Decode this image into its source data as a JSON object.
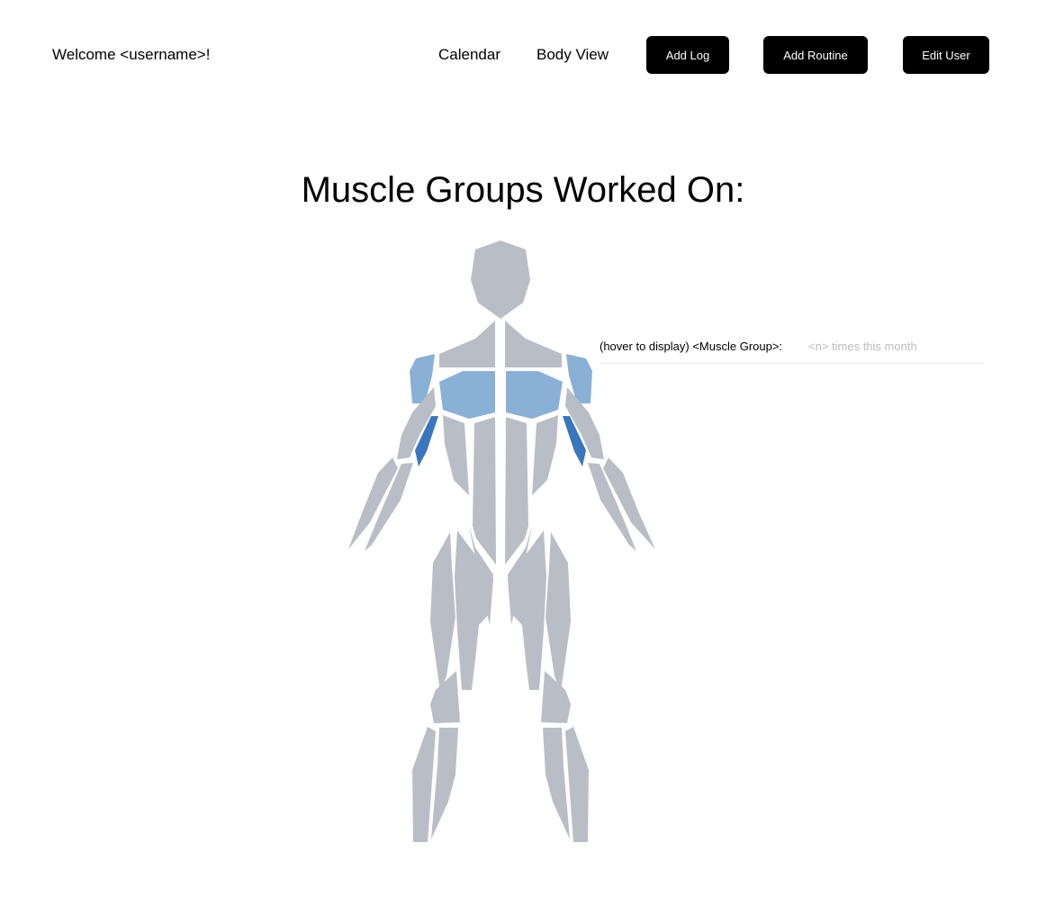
{
  "header": {
    "welcome": "Welcome <username>!",
    "nav": {
      "calendar": "Calendar",
      "body_view": "Body View"
    },
    "buttons": {
      "add_log": "Add Log",
      "add_routine": "Add Routine",
      "edit_user": "Edit User"
    }
  },
  "main": {
    "title": "Muscle Groups Worked On:",
    "hover_info": {
      "label": "(hover to display) <Muscle Group>:",
      "value": "<n> times this month"
    }
  },
  "colors": {
    "muscle_default": "#b9bec6",
    "muscle_light_blue": "#8ab0d6",
    "muscle_dark_blue": "#3a76bd",
    "button_bg": "#000000"
  }
}
